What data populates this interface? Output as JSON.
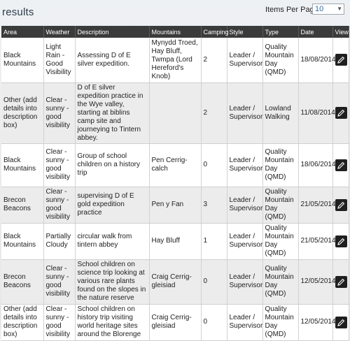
{
  "page": {
    "title": "results",
    "items_per_page_label": "Items Per Page",
    "items_per_page_value": "10"
  },
  "table": {
    "columns": [
      "Area",
      "Weather",
      "Description",
      "Mountains",
      "Camping",
      "Style",
      "Type",
      "Date",
      "View"
    ],
    "rows": [
      {
        "area": "Black Mountains",
        "weather": "Light Rain - Good Visibility",
        "description": "Assessing D of E silver expedition.",
        "mountains": "Mynydd Troed, Hay Bluff, Twmpa (Lord Hereford's Knob)",
        "camping": "2",
        "style": "Leader / Supervisor",
        "type": "Quality Mountain Day (QMD)",
        "date": "18/08/2014"
      },
      {
        "area": "Other (add details into description box)",
        "weather": "Clear - sunny - good visibility",
        "description": "D of E silver expedition practice in the Wye valley, starting at biblins camp site and journeying to Tintern abbey.",
        "mountains": "",
        "camping": "2",
        "style": "Leader / Supervisor",
        "type": "Lowland Walking",
        "date": "11/08/2014"
      },
      {
        "area": "Black Mountains",
        "weather": "Clear - sunny - good visibility",
        "description": "Group of school children on a history trip",
        "mountains": "Pen Cerrig-calch",
        "camping": "0",
        "style": "Leader / Supervisor",
        "type": "Quality Mountain Day (QMD)",
        "date": "18/06/2014"
      },
      {
        "area": "Brecon Beacons",
        "weather": "Clear - sunny - good visibility",
        "description": "supervising D of E gold expedition practice",
        "mountains": "Pen y Fan",
        "camping": "3",
        "style": "Leader / Supervisor",
        "type": "Quality Mountain Day (QMD)",
        "date": "21/05/2014"
      },
      {
        "area": "Black Mountains",
        "weather": "Partially Cloudy",
        "description": "circular walk from tintern abbey",
        "mountains": "Hay Bluff",
        "camping": "1",
        "style": "Leader / Supervisor",
        "type": "Quality Mountain Day (QMD)",
        "date": "21/05/2014"
      },
      {
        "area": "Brecon Beacons",
        "weather": "Clear - sunny - good visibility",
        "description": "School children on science trip looking at various rare plants found on the slopes in the nature reserve",
        "mountains": "Craig Cerrig-gleisiad",
        "camping": "0",
        "style": "Leader / Supervisor",
        "type": "Quality Mountain Day (QMD)",
        "date": "12/05/2014"
      },
      {
        "area": "Other (add details into description box)",
        "weather": "Clear - sunny - good visibility",
        "description": "School children on history trip visiting world heritage sites around the Blorenge",
        "mountains": "Craig Cerrig-gleisiad",
        "camping": "0",
        "style": "Leader / Supervisor",
        "type": "Quality Mountain Day (QMD)",
        "date": "12/05/2014"
      }
    ]
  },
  "icons": {
    "view": "edit-pencil-icon",
    "dropdown": "chevron-down-icon"
  }
}
